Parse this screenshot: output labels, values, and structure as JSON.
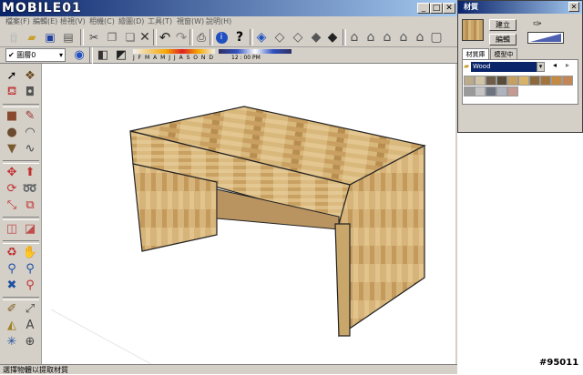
{
  "window": {
    "logo_text": "MOBILE01",
    "minimize": "_",
    "maximize": "□",
    "close": "✕"
  },
  "menu": [
    "檔案(F)",
    "編輯(E)",
    "檢視(V)",
    "相機(C)",
    "繪圖(D)",
    "工具(T)",
    "視窗(W)",
    "說明(H)"
  ],
  "toolbar2": {
    "layer_value": "圖層0",
    "months_label": "J F M A M J J A S O N D",
    "time_label": "12 : 00 PM"
  },
  "status": {
    "text": "選擇物體以提取材質"
  },
  "materials": {
    "title": "材質",
    "create_button": "建立",
    "edit_button": "編輯",
    "tab_library": "材質庫",
    "tab_model": "模型中",
    "library_value": "Wood",
    "swatch_colors": [
      "#b9ab8c",
      "#d0c3a6",
      "#6e5e49",
      "#574b3a",
      "#c6a061",
      "#d9b26a",
      "#8b6a3e",
      "#a4743f",
      "#c48b45",
      "#c38656",
      "#9a9a9a",
      "#c4c4c4",
      "#6e7380",
      "#aeb3bd",
      "#c49a93"
    ]
  },
  "watermark": "#95011"
}
